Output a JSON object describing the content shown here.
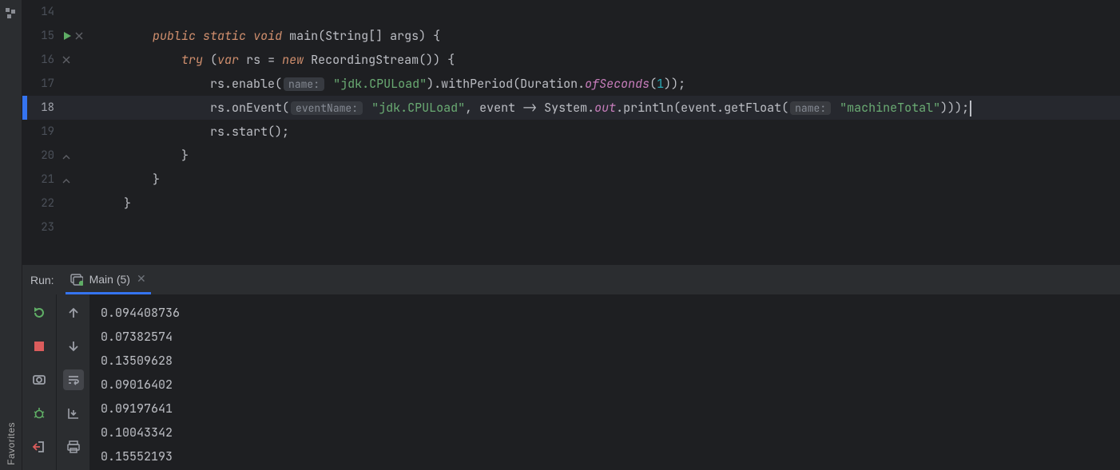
{
  "left_rail": {
    "structure_icon": "structure-icon",
    "label": "Favorites"
  },
  "editor": {
    "line_numbers": [
      14,
      15,
      16,
      17,
      18,
      19,
      20,
      21,
      22,
      23
    ],
    "current_line_index": 4,
    "run_marker_line_index": 1,
    "fold_marker_line_indexes": [
      1,
      2,
      6,
      7
    ],
    "hints": {
      "name": "name:",
      "eventName": "eventName:"
    },
    "code": {
      "l14": "",
      "l15_public": "public",
      "l15_static": "static",
      "l15_void": "void",
      "l15_main": "main",
      "l15_params": "(String[] args) {",
      "l16_try": "try",
      "l16_open": " (",
      "l16_var": "var",
      "l16_rs": " rs = ",
      "l16_new": "new",
      "l16_rest": " RecordingStream()) {",
      "l17_pre": "rs.enable(",
      "l17_str": "\"jdk.CPULoad\"",
      "l17_mid": ").withPeriod(Duration.",
      "l17_ofSeconds": "ofSeconds",
      "l17_open2": "(",
      "l17_num": "1",
      "l17_end": "));",
      "l18_pre": "rs.onEvent(",
      "l18_str": "\"jdk.CPULoad\"",
      "l18_mid1": ", event -> System.",
      "l18_out": "out",
      "l18_mid2": ".println(event.getFloat(",
      "l18_str2": "\"machineTotal\"",
      "l18_end": ")));",
      "l19": "rs.start();",
      "l20": "}",
      "l21": "}",
      "l22": "}"
    }
  },
  "run_panel": {
    "label": "Run:",
    "tab_title": "Main (5)",
    "output_lines": [
      "0.094408736",
      "0.07382574",
      "0.13509628",
      "0.09016402",
      "0.09197641",
      "0.10043342",
      "0.15552193"
    ],
    "toolbar1": [
      "rerun",
      "stop",
      "camera",
      "bug",
      "exit"
    ],
    "toolbar2": [
      "up",
      "down",
      "wrap",
      "scroll-end",
      "print"
    ]
  }
}
